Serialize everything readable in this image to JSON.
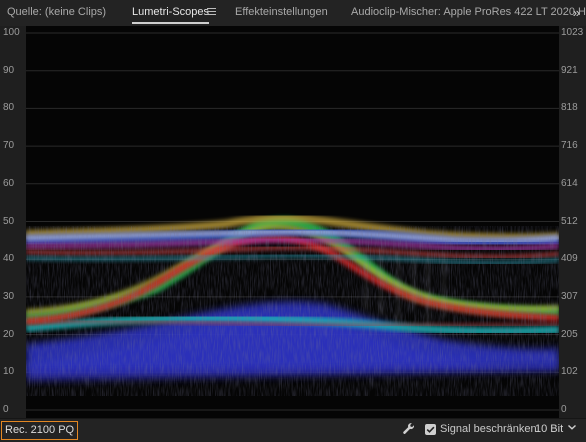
{
  "tabs": {
    "source": "Quelle: (keine Clips)",
    "scopes": "Lumetri-Scopes",
    "effects": "Effekteinstellungen",
    "audio": "Audioclip-Mischer: Apple ProRes 422 LT 2020 H"
  },
  "scope": {
    "left_axis": [
      "100",
      "90",
      "80",
      "70",
      "60",
      "50",
      "40",
      "30",
      "20",
      "10",
      "0"
    ],
    "right_axis": [
      "1023",
      "921",
      "818",
      "716",
      "614",
      "512",
      "409",
      "307",
      "205",
      "102",
      "0"
    ]
  },
  "footer": {
    "colorspace": "Rec. 2100 PQ",
    "clamp_label": "Signal beschränken",
    "clamp_checked": true,
    "bit_depth": "10 Bit"
  },
  "colors": {
    "accent_orange": "#e38723",
    "panel_bg": "#232323",
    "scope_bg": "#050505"
  }
}
